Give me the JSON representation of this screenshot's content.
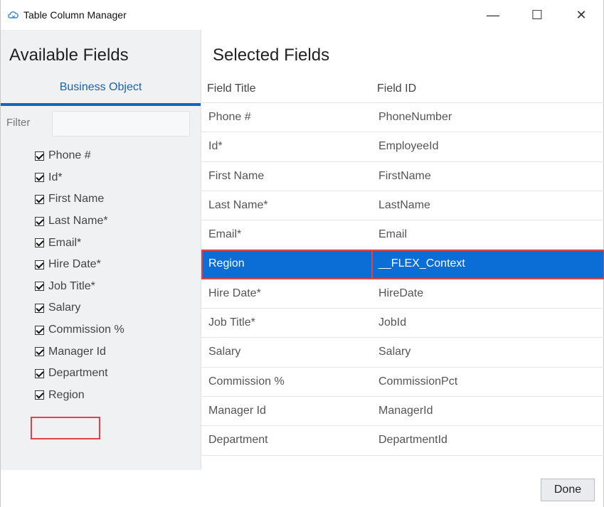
{
  "window": {
    "title": "Table Column Manager",
    "controls": {
      "minimize": "—",
      "maximize": "☐",
      "close": "✕"
    }
  },
  "available": {
    "title": "Available Fields",
    "tab_label": "Business Object",
    "filter_label": "Filter",
    "filter_value": "",
    "items": [
      {
        "label": "Phone #",
        "checked": true
      },
      {
        "label": "Id*",
        "checked": true
      },
      {
        "label": "First Name",
        "checked": true
      },
      {
        "label": "Last Name*",
        "checked": true
      },
      {
        "label": "Email*",
        "checked": true
      },
      {
        "label": "Hire Date*",
        "checked": true
      },
      {
        "label": "Job Title*",
        "checked": true
      },
      {
        "label": "Salary",
        "checked": true
      },
      {
        "label": "Commission %",
        "checked": true
      },
      {
        "label": "Manager Id",
        "checked": true
      },
      {
        "label": "Department",
        "checked": true
      },
      {
        "label": "Region",
        "checked": true
      }
    ]
  },
  "selected": {
    "title": "Selected Fields",
    "columns": [
      "Field Title",
      "Field ID"
    ],
    "rows": [
      {
        "title": "Phone #",
        "id": "PhoneNumber",
        "selected": false
      },
      {
        "title": "Id*",
        "id": "EmployeeId",
        "selected": false
      },
      {
        "title": "First Name",
        "id": "FirstName",
        "selected": false
      },
      {
        "title": "Last Name*",
        "id": "LastName",
        "selected": false
      },
      {
        "title": "Email*",
        "id": "Email",
        "selected": false
      },
      {
        "title": "Region",
        "id": "__FLEX_Context",
        "selected": true
      },
      {
        "title": "Hire Date*",
        "id": "HireDate",
        "selected": false
      },
      {
        "title": "Job Title*",
        "id": "JobId",
        "selected": false
      },
      {
        "title": "Salary",
        "id": "Salary",
        "selected": false
      },
      {
        "title": "Commission %",
        "id": "CommissionPct",
        "selected": false
      },
      {
        "title": "Manager Id",
        "id": "ManagerId",
        "selected": false
      },
      {
        "title": "Department",
        "id": "DepartmentId",
        "selected": false
      }
    ]
  },
  "footer": {
    "done_label": "Done"
  },
  "colors": {
    "accent": "#0b6ed6",
    "highlight": "#e0424a",
    "tab_text": "#1a63b0"
  }
}
